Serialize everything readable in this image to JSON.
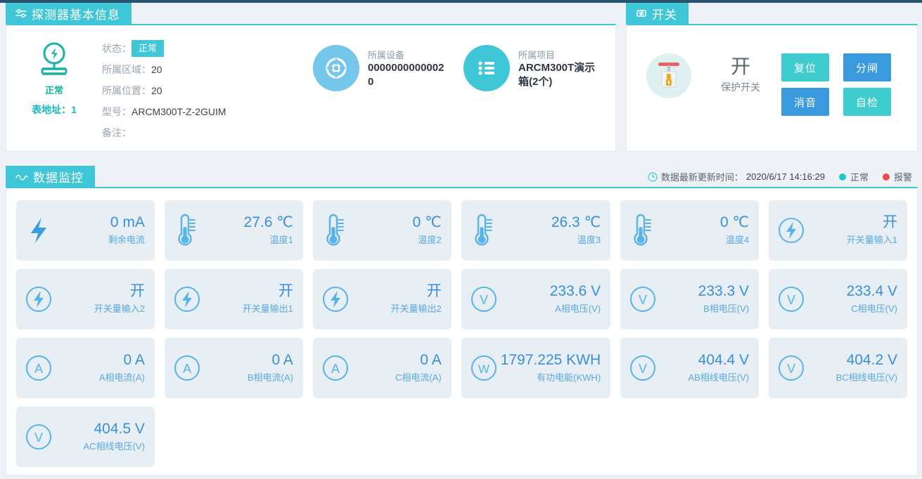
{
  "detector": {
    "header": {
      "title": "探测器基本信息",
      "icon": "sliders-icon"
    },
    "status_icon": {
      "icon": "ground-fault-detector-icon",
      "label": "正常"
    },
    "meter_address": "表地址：1",
    "fields": [
      {
        "key": "状态：",
        "value": "正常",
        "is_badge": true
      },
      {
        "key": "所属区域：",
        "value": "20",
        "is_badge": false
      },
      {
        "key": "所属位置：",
        "value": "20",
        "is_badge": false
      },
      {
        "key": "型号：",
        "value": "ARCM300T-Z-2GUIM",
        "is_badge": false
      },
      {
        "key": "备注：",
        "value": "",
        "is_badge": false
      }
    ],
    "tiles": [
      {
        "icon": "lifebuoy-icon",
        "label": "所属设备",
        "value": "00000000000020",
        "color": "#74c7ea"
      },
      {
        "icon": "list-icon",
        "label": "所属项目",
        "value": "ARCM300T演示箱(2个)",
        "color": "#3fc7d8"
      }
    ]
  },
  "switch": {
    "header": {
      "title": "开关",
      "icon": "switch-transfer-icon"
    },
    "device_icon": "circuit-breaker-icon",
    "state": "开",
    "name": "保护开关",
    "buttons": [
      {
        "label": "复位",
        "style": "teal"
      },
      {
        "label": "分闸",
        "style": "blue"
      },
      {
        "label": "消音",
        "style": "blue"
      },
      {
        "label": "自检",
        "style": "teal"
      }
    ]
  },
  "monitor": {
    "header": {
      "title": "数据监控",
      "icon": "wave-icon"
    },
    "update_label": "数据最新更新时间：",
    "update_time": "2020/6/17 14:16:29",
    "clock_icon": "clock-icon",
    "legend": [
      {
        "label": "正常",
        "color": "#1fc5c8"
      },
      {
        "label": "报警",
        "color": "#ef4b4b"
      }
    ],
    "cards": [
      {
        "icon": "bolt-icon",
        "value": "0 mA",
        "label": "剩余电流"
      },
      {
        "icon": "thermometer-icon",
        "value": "27.6 ℃",
        "label": "温度1"
      },
      {
        "icon": "thermometer-icon",
        "value": "0 ℃",
        "label": "温度2"
      },
      {
        "icon": "thermometer-icon",
        "value": "26.3 ℃",
        "label": "温度3"
      },
      {
        "icon": "thermometer-icon",
        "value": "0 ℃",
        "label": "温度4"
      },
      {
        "icon": "bolt-circle-icon",
        "value": "开",
        "label": "开关量输入1"
      },
      {
        "icon": "bolt-circle-icon",
        "value": "开",
        "label": "开关量输入2"
      },
      {
        "icon": "bolt-circle-icon",
        "value": "开",
        "label": "开关量输出1"
      },
      {
        "icon": "bolt-circle-icon",
        "value": "开",
        "label": "开关量输出2"
      },
      {
        "icon": "volt-circle-icon",
        "value": "233.6 V",
        "label": "A相电压(V)"
      },
      {
        "icon": "volt-circle-icon",
        "value": "233.3 V",
        "label": "B相电压(V)"
      },
      {
        "icon": "volt-circle-icon",
        "value": "233.4 V",
        "label": "C相电压(V)"
      },
      {
        "icon": "amp-circle-icon",
        "value": "0 A",
        "label": "A相电流(A)"
      },
      {
        "icon": "amp-circle-icon",
        "value": "0 A",
        "label": "B相电流(A)"
      },
      {
        "icon": "amp-circle-icon",
        "value": "0 A",
        "label": "C相电流(A)"
      },
      {
        "icon": "watt-circle-icon",
        "value": "1797.225 KWH",
        "label": "有功电能(KWH)"
      },
      {
        "icon": "volt-circle-icon",
        "value": "404.4 V",
        "label": "AB相线电压(V)"
      },
      {
        "icon": "volt-circle-icon",
        "value": "404.2 V",
        "label": "BC相线电压(V)"
      },
      {
        "icon": "volt-circle-icon",
        "value": "404.5 V",
        "label": "AC相线电压(V)"
      }
    ]
  },
  "colors": {
    "accent_teal": "#3fc7d8",
    "accent_blue": "#3b9ade",
    "card_bg": "#e7eef4",
    "value_blue": "#3a8fd8",
    "label_blue": "#5aa9e0",
    "alarm_red": "#ef4b4b"
  }
}
